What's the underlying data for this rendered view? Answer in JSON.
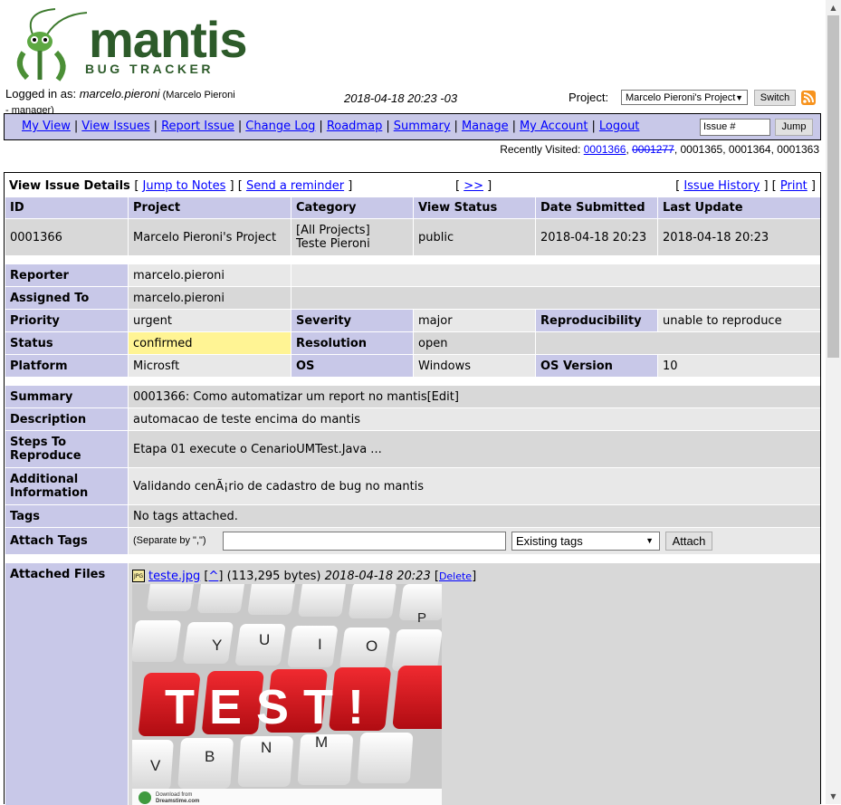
{
  "logo": {
    "word": "mantis",
    "sub": "BUG TRACKER"
  },
  "login": {
    "prefix": "Logged in as: ",
    "user": "marcelo.pieroni",
    "detail_open": " (Marcelo Pieroni",
    "detail_cont": "- manager)"
  },
  "datetime": "2018-04-18 20:23 -03",
  "project": {
    "label": "Project:",
    "selected": "Marcelo Pieroni's Project",
    "switch_label": "Switch"
  },
  "menu": {
    "items": [
      "My View",
      "View Issues",
      "Report Issue",
      "Change Log",
      "Roadmap",
      "Summary",
      "Manage",
      "My Account",
      "Logout"
    ],
    "issue_placeholder": "Issue #",
    "jump_label": "Jump"
  },
  "recently_visited": {
    "label": "Recently Visited: ",
    "ids": [
      "0001366",
      "0001277",
      "0001365",
      "0001364",
      "0001363"
    ],
    "struck": "0001277"
  },
  "details": {
    "title": "View Issue Details",
    "jump_to_notes": "Jump to Notes",
    "send_reminder": "Send a reminder",
    "next": ">>",
    "issue_history": "Issue History",
    "print": "Print",
    "headers": [
      "ID",
      "Project",
      "Category",
      "View Status",
      "Date Submitted",
      "Last Update"
    ],
    "values": {
      "id": "0001366",
      "project": "Marcelo Pieroni's Project",
      "category_line1": "[All Projects]",
      "category_line2": "Teste Pieroni",
      "view_status": "public",
      "date_submitted": "2018-04-18 20:23",
      "last_update": "2018-04-18 20:23"
    },
    "reporter_label": "Reporter",
    "reporter": "marcelo.pieroni",
    "assigned_label": "Assigned To",
    "assigned": "marcelo.pieroni",
    "priority_label": "Priority",
    "priority": "urgent",
    "severity_label": "Severity",
    "severity": "major",
    "reproducibility_label": "Reproducibility",
    "reproducibility": "unable to reproduce",
    "status_label": "Status",
    "status": "confirmed",
    "resolution_label": "Resolution",
    "resolution": "open",
    "platform_label": "Platform",
    "platform": "Microsft",
    "os_label": "OS",
    "os": "Windows",
    "os_version_label": "OS Version",
    "os_version": "10",
    "summary_label": "Summary",
    "summary": "0001366: Como automatizar um report no mantis[Edit]",
    "description_label": "Description",
    "description": "automacao de teste encima do mantis",
    "steps_label_1": "Steps To",
    "steps_label_2": "Reproduce",
    "steps": "Etapa 01 execute o CenarioUMTest.Java ...",
    "additional_label_1": "Additional",
    "additional_label_2": "Information",
    "additional": "Validando cenÃ¡rio de cadastro de bug no mantis",
    "tags_label": "Tags",
    "tags": "No tags attached.",
    "attach_tags_label": "Attach Tags",
    "attach_tags_hint": "(Separate by \",\")",
    "existing_tags": "Existing tags",
    "attach_label": "Attach",
    "attached_files_label": "Attached Files",
    "file": {
      "name": "teste.jpg",
      "caret": "^",
      "size": "(113,295 bytes)",
      "date": "2018-04-18 20:23",
      "delete": "Delete"
    }
  },
  "preview": {
    "word": "TEST!",
    "keys_top": [
      "Y",
      "U",
      "I",
      "O",
      "P"
    ],
    "keys_bottom": [
      "V",
      "B",
      "N",
      "M"
    ],
    "watermark_1": "Download from",
    "watermark_2": "Dreamstime.com"
  },
  "colors": {
    "header": "#c8c8e8",
    "row_dark": "#d8d8d8",
    "row_light": "#e8e8e8",
    "status_confirmed": "#fff494",
    "link": "#0000ff",
    "logo_green": "#2d5b2a",
    "key_red": "#d8141c"
  }
}
